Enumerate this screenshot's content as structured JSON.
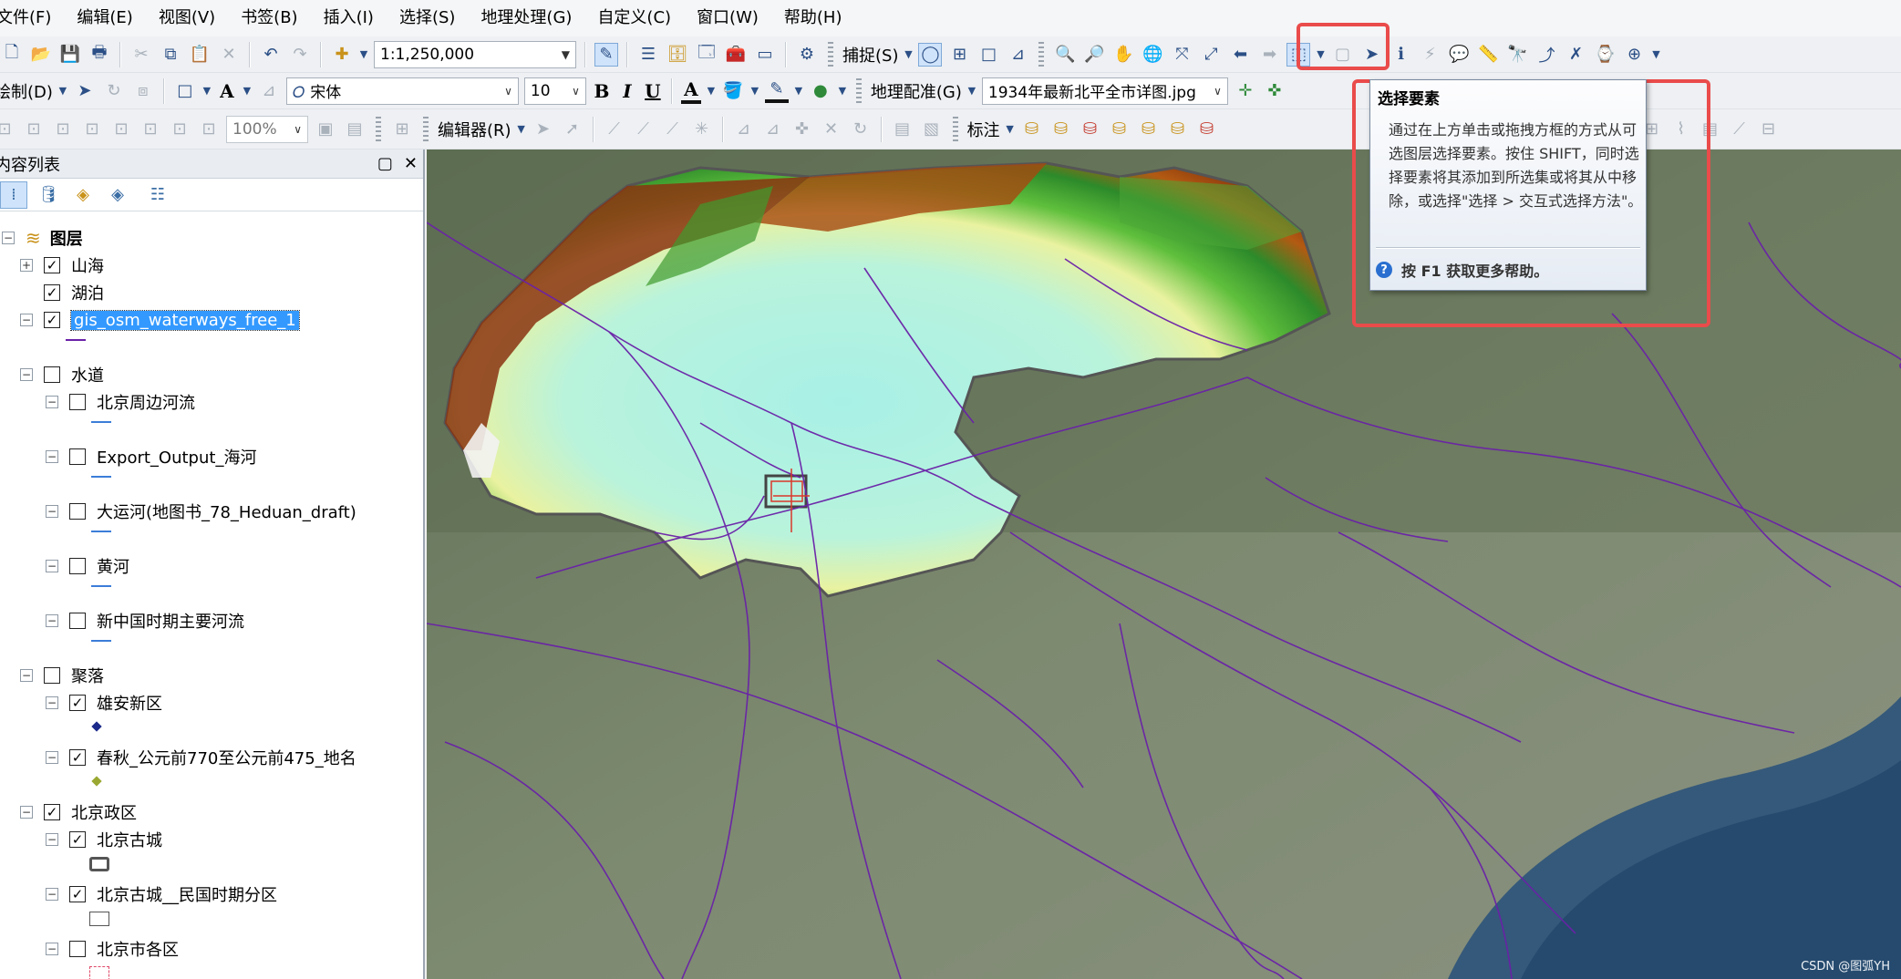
{
  "menu": [
    "文件(F)",
    "编辑(E)",
    "视图(V)",
    "书签(B)",
    "插入(I)",
    "选择(S)",
    "地理处理(G)",
    "自定义(C)",
    "窗口(W)",
    "帮助(H)"
  ],
  "toolbar1": {
    "scale": "1:1,250,000",
    "snapping_label": "捕捉(S)"
  },
  "toolbar2": {
    "draw_label": "绘制(D)",
    "font_name": "宋体",
    "font_size": "10",
    "bold": "B",
    "italic": "I",
    "underline": "U",
    "georef_label": "地理配准(G)",
    "georef_layer": "1934年最新北平全市详图.jpg"
  },
  "toolbar3": {
    "zoom": "100%",
    "editor_label": "编辑器(R)",
    "label_label": "标注"
  },
  "toc": {
    "title": "内容列表",
    "root": "图层",
    "layers": [
      "山海",
      "湖泊",
      "gis_osm_waterways_free_1",
      "水道",
      "北京周边河流",
      "Export_Output_海河",
      "大运河(地图书_78_Heduan_draft)",
      "黄河",
      "新中国时期主要河流",
      "聚落",
      "雄安新区",
      "春秋_公元前770至公元前475_地名",
      "北京政区",
      "北京古城",
      "北京古城__民国时期分区",
      "北京市各区"
    ]
  },
  "tooltip": {
    "title": "选择要素",
    "body": "通过在上方单击或拖拽方框的方式从可选图层选择要素。按住 SHIFT，同时选择要素将其添加到所选集或将其从中移除，或选择\"选择 > 交互式选择方法\"。",
    "help": "按 F1 获取更多帮助。"
  },
  "watermark": "CSDN @图弧YH",
  "colors": {
    "highlight": "#ea4b4b",
    "water_line": "#6a21a8",
    "selection": "#3399ff"
  }
}
